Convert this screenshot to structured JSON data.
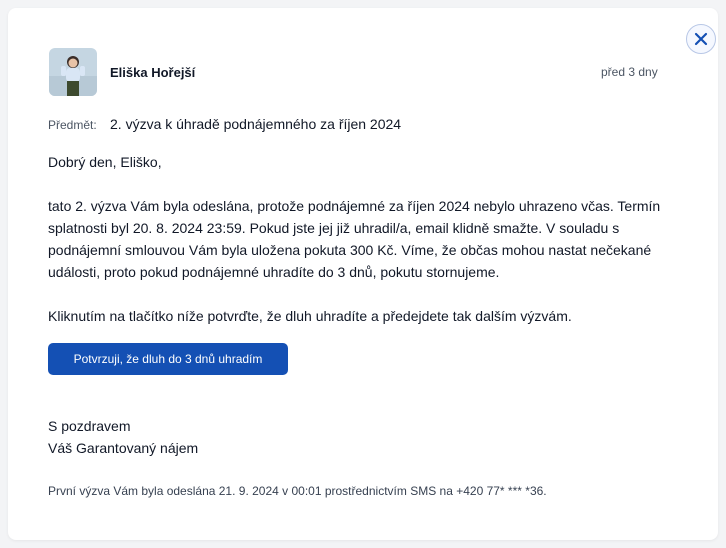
{
  "message": {
    "sender": "Eliška Hořejší",
    "time": "před 3 dny",
    "subject_label": "Předmět:",
    "subject": "2. výzva k úhradě podnájemného za říjen 2024",
    "greeting": "Dobrý den, Eliško,",
    "body": "tato 2. výzva Vám byla odeslána, protože podnájemné za říjen 2024 nebylo uhrazeno včas. Termín splatnosti byl 20. 8. 2024 23:59. Pokud jste jej již uhradil/a, email klidně smažte. V souladu s podnájemní smlouvou Vám byla uložena pokuta 300 Kč. Víme, že občas mohou nastat nečekané události, proto pokud podnájemné uhradíte do 3 dnů, pokutu stornujeme.",
    "instruction": "Kliknutím na tlačítko níže potvrďte, že dluh uhradíte a předejdete tak dalším výzvám.",
    "cta_label": "Potvrzuji, že dluh do 3 dnů uhradím",
    "sign_off": "S pozdravem",
    "signature": "Váš Garantovaný nájem",
    "footer": "První výzva Vám byla odeslána 21. 9. 2024 v 00:01 prostřednictvím SMS na +420 77* *** *36."
  },
  "icons": {
    "close": "close-icon",
    "avatar": "avatar"
  },
  "colors": {
    "primary": "#1450b4",
    "close_border": "#b8c7e6"
  }
}
